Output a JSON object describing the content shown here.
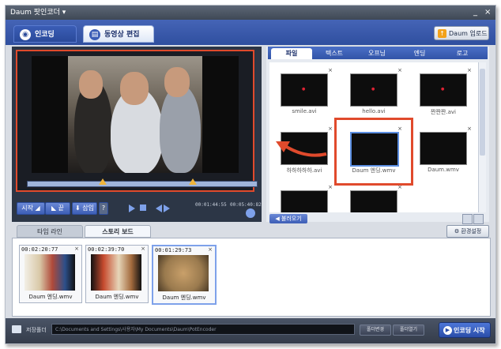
{
  "window": {
    "title": "Daum 팟인코더 ▾",
    "minimize": "_",
    "close": "×"
  },
  "main_tabs": [
    {
      "label": "인코딩",
      "icon": "disc-icon"
    },
    {
      "label": "동영상 편집",
      "icon": "film-icon"
    }
  ],
  "upload_button": "Daum 업로드",
  "player": {
    "buttons": {
      "start": "시작 ◢",
      "end": "◣ 끝",
      "insert": "⬇ 삽입",
      "help": "?"
    },
    "time_current": "00:01:44:55",
    "time_total": "00:05:40:82",
    "seek_position_percent": 72
  },
  "right_tabs": [
    "파일",
    "텍스트",
    "오프닝",
    "엔딩",
    "로고"
  ],
  "files": [
    {
      "name": "smile.avi"
    },
    {
      "name": "hello.avi"
    },
    {
      "name": "짠짠짠.avi"
    },
    {
      "name": "하하하하하.avi"
    },
    {
      "name": "Daum 엔딩.wmv"
    },
    {
      "name": "Daum.wmv"
    },
    {
      "name": ""
    },
    {
      "name": ""
    }
  ],
  "recall_button": "◀ 불러오기",
  "lower_tabs": [
    "타임 라인",
    "스토리 보드"
  ],
  "settings_button": "환경설정",
  "storyboard": [
    {
      "time": "00:02:20:77",
      "name": "Daum 엔딩.wmv"
    },
    {
      "time": "00:02:39:70",
      "name": "Daum 엔딩.wmv"
    },
    {
      "time": "00:01:29:73",
      "name": "Daum 엔딩.wmv"
    }
  ],
  "footer": {
    "save_label": "저장폴더",
    "path": "C:\\Documents and Settings\\사용자\\My Documents\\Daum\\PotEncoder",
    "change_folder": "폴더변경",
    "open_folder": "폴더열기",
    "start_encoding": "인코딩 시작"
  },
  "colors": {
    "highlight": "#e04a2c",
    "accent_blue": "#3d5eb6"
  }
}
